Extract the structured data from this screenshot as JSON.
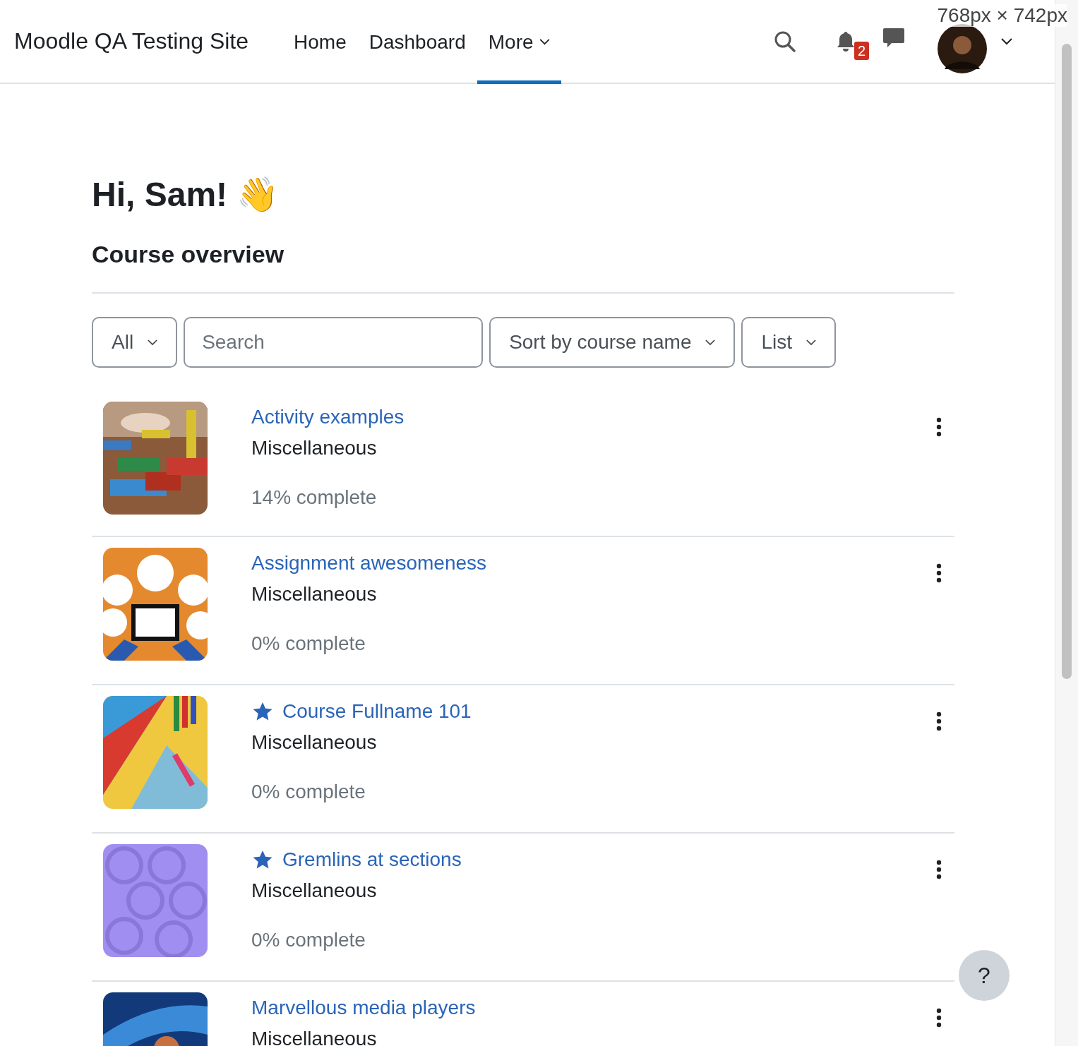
{
  "navbar": {
    "site_name": "Moodle QA Testing Site",
    "nav_items": [
      {
        "label": "Home",
        "selected": false,
        "has_menu": false
      },
      {
        "label": "Dashboard",
        "selected": false,
        "has_menu": false
      },
      {
        "label": "More",
        "selected": true,
        "has_menu": true
      }
    ],
    "notification_count": "2"
  },
  "viewport_label": "768px × 742px",
  "greeting": "Hi, Sam! 👋",
  "section_title": "Course overview",
  "filters": {
    "grouping": "All",
    "search": {
      "placeholder": "Search"
    },
    "sort": "Sort by course name",
    "view": "List"
  },
  "courses": [
    {
      "name": "Activity examples",
      "category": "Miscellaneous",
      "progress": "14% complete",
      "starred": false
    },
    {
      "name": "Assignment awesomeness",
      "category": "Miscellaneous",
      "progress": "0% complete",
      "starred": false
    },
    {
      "name": "Course Fullname 101",
      "category": "Miscellaneous",
      "progress": "0% complete",
      "starred": true
    },
    {
      "name": "Gremlins at sections",
      "category": "Miscellaneous",
      "progress": "0% complete",
      "starred": true
    },
    {
      "name": "Marvellous media players",
      "category": "Miscellaneous",
      "starred": false
    }
  ],
  "help_button": "?"
}
